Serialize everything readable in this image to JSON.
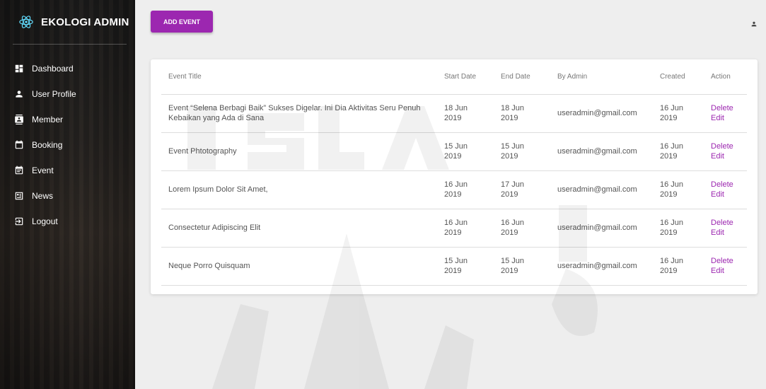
{
  "brand": {
    "title": "EKOLOGI ADMIN",
    "logo_icon": "atom-icon"
  },
  "sidebar": {
    "items": [
      {
        "label": "Dashboard",
        "icon": "dashboard-icon"
      },
      {
        "label": "User Profile",
        "icon": "person-icon"
      },
      {
        "label": "Member",
        "icon": "contact-card-icon"
      },
      {
        "label": "Booking",
        "icon": "calendar-icon"
      },
      {
        "label": "Event",
        "icon": "event-note-icon"
      },
      {
        "label": "News",
        "icon": "news-icon"
      },
      {
        "label": "Logout",
        "icon": "logout-icon"
      }
    ]
  },
  "toolbar": {
    "add_label": "ADD EVENT",
    "accent": "#9c27b0"
  },
  "table": {
    "headers": {
      "title": "Event Title",
      "start": "Start Date",
      "end": "End Date",
      "admin": "By Admin",
      "created": "Created",
      "action": "Action"
    },
    "rows": [
      {
        "title": "Event “Selena Berbagi Baik” Sukses Digelar. Ini Dia Aktivitas Seru Penuh Kebaikan yang Ada di Sana",
        "start_day": "18 Jun",
        "start_year": "2019",
        "end_day": "18 Jun",
        "end_year": "2019",
        "admin": "useradmin@gmail.com",
        "created_day": "16 Jun",
        "created_year": "2019",
        "delete": "Delete",
        "edit": "Edit"
      },
      {
        "title": "Event Phtotography",
        "start_day": "15 Jun",
        "start_year": "2019",
        "end_day": "15 Jun",
        "end_year": "2019",
        "admin": "useradmin@gmail.com",
        "created_day": "16 Jun",
        "created_year": "2019",
        "delete": "Delete",
        "edit": "Edit"
      },
      {
        "title": "Lorem Ipsum Dolor Sit Amet,",
        "start_day": "16 Jun",
        "start_year": "2019",
        "end_day": "17 Jun",
        "end_year": "2019",
        "admin": "useradmin@gmail.com",
        "created_day": "16 Jun",
        "created_year": "2019",
        "delete": "Delete",
        "edit": "Edit"
      },
      {
        "title": "Consectetur Adipiscing Elit",
        "start_day": "16 Jun",
        "start_year": "2019",
        "end_day": "16 Jun",
        "end_year": "2019",
        "admin": "useradmin@gmail.com",
        "created_day": "16 Jun",
        "created_year": "2019",
        "delete": "Delete",
        "edit": "Edit"
      },
      {
        "title": "Neque Porro Quisquam",
        "start_day": "15 Jun",
        "start_year": "2019",
        "end_day": "15 Jun",
        "end_year": "2019",
        "admin": "useradmin@gmail.com",
        "created_day": "16 Jun",
        "created_year": "2019",
        "delete": "Delete",
        "edit": "Edit"
      }
    ]
  }
}
